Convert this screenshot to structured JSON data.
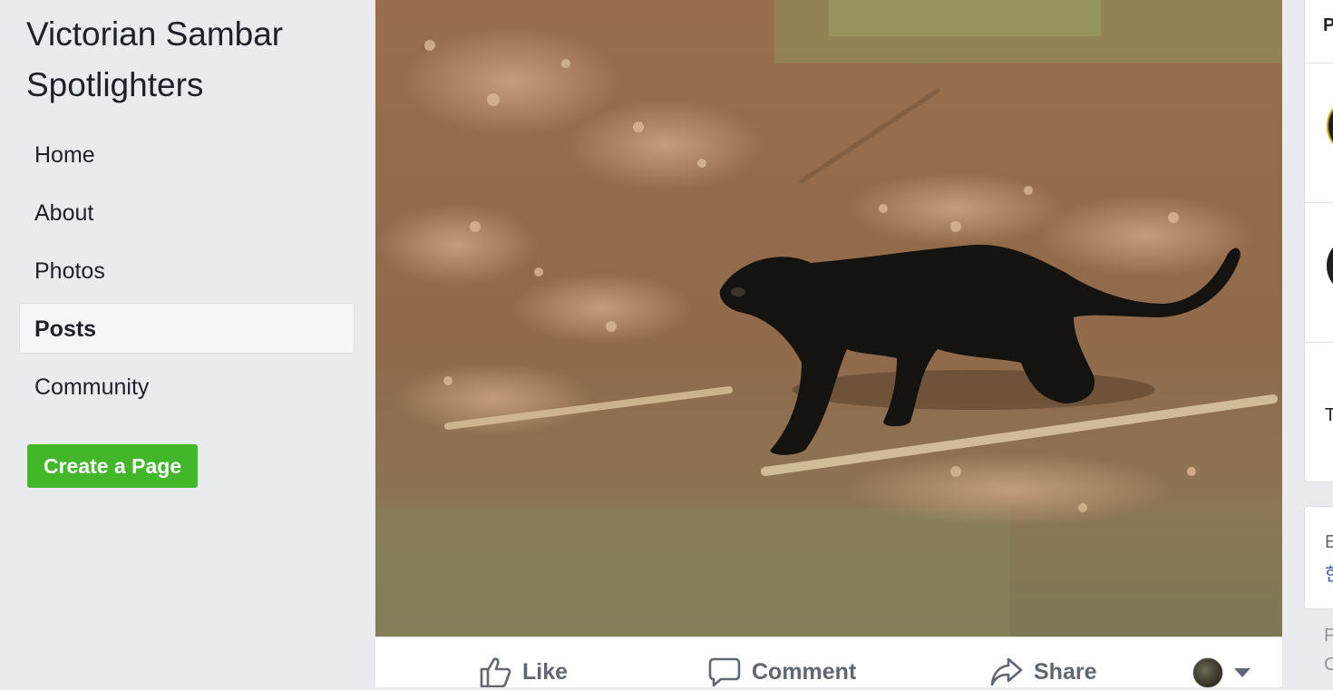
{
  "sidebar": {
    "page_name": "Victorian Sambar Spotlighters",
    "nav": [
      {
        "label": "Home",
        "active": false
      },
      {
        "label": "About",
        "active": false
      },
      {
        "label": "Photos",
        "active": false
      },
      {
        "label": "Posts",
        "active": true
      },
      {
        "label": "Community",
        "active": false
      }
    ],
    "create_page_label": "Create a Page",
    "create_page_color": "#42b72a"
  },
  "post": {
    "photo_icon": "black-panther-photo",
    "actions": {
      "like_label": "Like",
      "comment_label": "Comment",
      "share_label": "Share"
    },
    "action_icons": [
      "thumbs-up-icon",
      "comment-bubble-icon",
      "share-arrow-icon",
      "caret-down-icon"
    ]
  },
  "right_column": {
    "card1_header": "P",
    "card1_text": "T",
    "card2_line1": "E",
    "card2_line2": "한",
    "footer_line1": "P",
    "footer_line2": "C"
  },
  "colors": {
    "background": "#e9ebee",
    "text_primary": "#1d2129",
    "text_secondary": "#606770",
    "link": "#385898"
  }
}
